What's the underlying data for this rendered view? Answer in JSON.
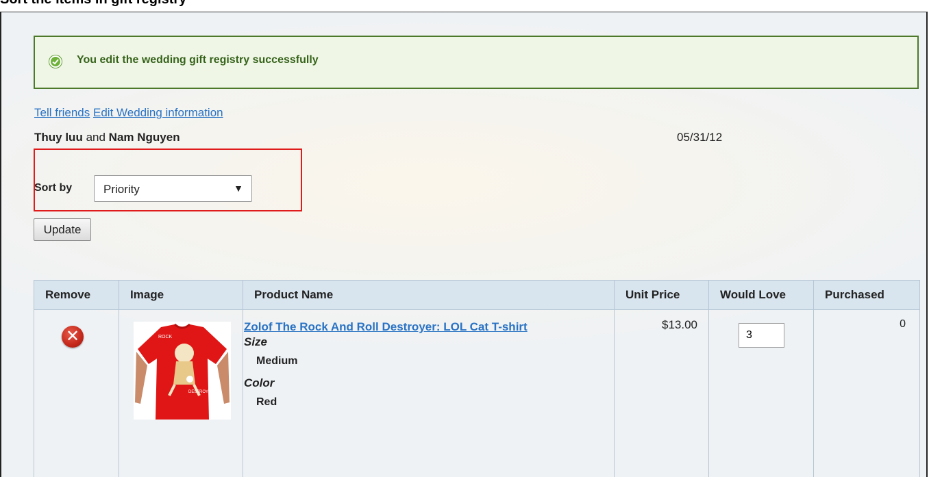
{
  "doc_heading": "Sort the items in gift registry",
  "message": {
    "text": "You edit the wedding gift registry successfully",
    "color": "#35631a"
  },
  "links": {
    "tell_friends": "Tell friends",
    "edit_wedding": "Edit Wedding information"
  },
  "couple": {
    "name1": "Thuy luu",
    "and": "and",
    "name2": "Nam Nguyen"
  },
  "date": "05/31/12",
  "sort": {
    "label": "Sort by",
    "selected": "Priority"
  },
  "update_button": "Update",
  "table": {
    "headers": {
      "remove": "Remove",
      "image": "Image",
      "product_name": "Product Name",
      "unit_price": "Unit Price",
      "would_love": "Would Love",
      "purchased": "Purchased"
    },
    "rows": [
      {
        "product_name": "Zolof The Rock And Roll Destroyer: LOL Cat T-shirt",
        "attributes": [
          {
            "name": "Size",
            "value": "Medium"
          },
          {
            "name": "Color",
            "value": "Red"
          }
        ],
        "unit_price": "$13.00",
        "would_love": "3",
        "purchased": "0"
      }
    ]
  },
  "colors": {
    "success_border": "#4d7a2a",
    "success_bg": "#f0f6e6",
    "highlight_border": "#e01b1b",
    "link": "#2a73c4",
    "table_header_bg": "#d8e4ee",
    "tshirt": "#e01616"
  }
}
